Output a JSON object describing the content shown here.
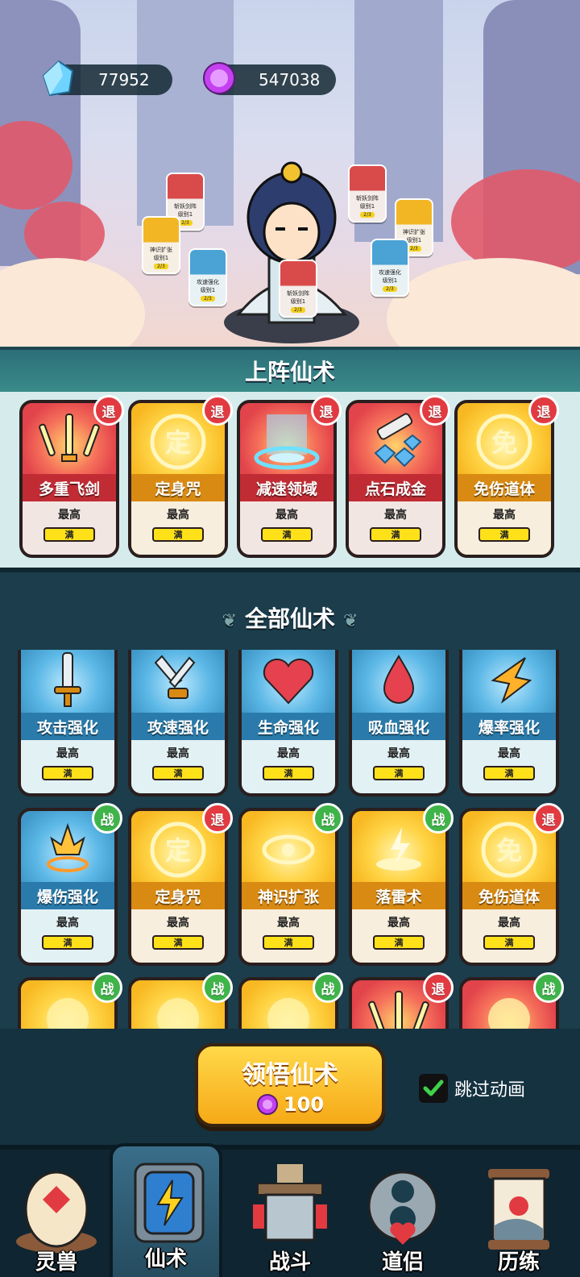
{
  "currencies": {
    "diamond": {
      "icon": "diamond-icon",
      "value": "77952"
    },
    "purple_gem": {
      "icon": "purple-gem-icon",
      "value": "547038"
    }
  },
  "hero": {
    "orbit_cards": [
      {
        "name": "斩妖剑阵",
        "level": "级别1",
        "progress": "2/3",
        "color": "red"
      },
      {
        "name": "神识扩张",
        "level": "级别1",
        "progress": "2/3",
        "color": "gold"
      },
      {
        "name": "攻速强化",
        "level": "级别1",
        "progress": "2/3",
        "color": "blue"
      },
      {
        "name": "斩妖剑阵",
        "level": "级别1",
        "progress": "2/3",
        "color": "red"
      },
      {
        "name": "斩妖剑阵",
        "level": "级别1",
        "progress": "2/3",
        "color": "red"
      },
      {
        "name": "神识扩张",
        "level": "级别1",
        "progress": "2/3",
        "color": "gold"
      },
      {
        "name": "攻速强化",
        "level": "级别1",
        "progress": "2/3",
        "color": "blue"
      }
    ]
  },
  "equipped": {
    "title": "上阵仙术",
    "cards": [
      {
        "name": "多重飞剑",
        "color": "red",
        "badge": "退",
        "max_label": "最高",
        "status": "满",
        "art": "swords-icon"
      },
      {
        "name": "定身咒",
        "color": "gold",
        "badge": "退",
        "max_label": "最高",
        "status": "满",
        "art": "seal-ding-icon",
        "art_text": "定"
      },
      {
        "name": "减速领域",
        "color": "red",
        "badge": "退",
        "max_label": "最高",
        "status": "满",
        "art": "slow-field-icon"
      },
      {
        "name": "点石成金",
        "color": "red",
        "badge": "退",
        "max_label": "最高",
        "status": "满",
        "art": "gold-stone-icon"
      },
      {
        "name": "免伤道体",
        "color": "gold",
        "badge": "退",
        "max_label": "最高",
        "status": "满",
        "art": "shield-icon",
        "art_text": "免"
      }
    ]
  },
  "all_spells": {
    "title": "全部仙术",
    "cards": [
      {
        "name": "攻击强化",
        "color": "blue",
        "badge": "",
        "max_label": "最高",
        "status": "满",
        "art": "sword-icon"
      },
      {
        "name": "攻速强化",
        "color": "blue",
        "badge": "",
        "max_label": "最高",
        "status": "满",
        "art": "double-sword-icon"
      },
      {
        "name": "生命强化",
        "color": "blue",
        "badge": "",
        "max_label": "最高",
        "status": "满",
        "art": "heart-icon"
      },
      {
        "name": "吸血强化",
        "color": "blue",
        "badge": "",
        "max_label": "最高",
        "status": "满",
        "art": "blood-drop-icon"
      },
      {
        "name": "爆率强化",
        "color": "blue",
        "badge": "",
        "max_label": "最高",
        "status": "满",
        "art": "crit-rate-icon"
      },
      {
        "name": "爆伤强化",
        "color": "blue",
        "badge": "战",
        "max_label": "最高",
        "status": "满",
        "art": "crit-damage-icon"
      },
      {
        "name": "定身咒",
        "color": "gold",
        "badge": "退",
        "max_label": "最高",
        "status": "满",
        "art": "seal-ding-icon",
        "art_text": "定"
      },
      {
        "name": "神识扩张",
        "color": "gold",
        "badge": "战",
        "max_label": "最高",
        "status": "满",
        "art": "eye-icon"
      },
      {
        "name": "落雷术",
        "color": "gold",
        "badge": "战",
        "max_label": "最高",
        "status": "满",
        "art": "lightning-icon"
      },
      {
        "name": "免伤道体",
        "color": "gold",
        "badge": "退",
        "max_label": "最高",
        "status": "满",
        "art": "shield-icon",
        "art_text": "免"
      },
      {
        "name": "",
        "color": "gold",
        "badge": "战",
        "max_label": "",
        "status": "",
        "art": "flying-sword-icon"
      },
      {
        "name": "",
        "color": "gold",
        "badge": "战",
        "max_label": "",
        "status": "",
        "art": "sword-wave-icon"
      },
      {
        "name": "",
        "color": "gold",
        "badge": "战",
        "max_label": "",
        "status": "",
        "art": "dragon-icon"
      },
      {
        "name": "",
        "color": "red",
        "badge": "退",
        "max_label": "",
        "status": "",
        "art": "swords-icon"
      },
      {
        "name": "",
        "color": "red",
        "badge": "战",
        "max_label": "",
        "status": "",
        "art": "target-sword-icon"
      }
    ]
  },
  "actions": {
    "learn_button": "领悟仙术",
    "learn_cost": "100",
    "skip_animation": "跳过动画",
    "skip_checked": true
  },
  "nav": {
    "items": [
      {
        "label": "灵兽",
        "icon": "spirit-beast-egg-icon",
        "active": false
      },
      {
        "label": "仙术",
        "icon": "spell-cards-icon",
        "active": true
      },
      {
        "label": "战斗",
        "icon": "battle-altar-icon",
        "active": false
      },
      {
        "label": "道侣",
        "icon": "companion-icon",
        "active": false
      },
      {
        "label": "历练",
        "icon": "scroll-icon",
        "active": false
      }
    ]
  },
  "colors": {
    "red": "#e2444b",
    "gold": "#f7b822",
    "blue": "#3f98c8",
    "retreat_badge": "#e23a41",
    "fight_badge": "#3fb449",
    "full_bar": "#ffe11a"
  }
}
